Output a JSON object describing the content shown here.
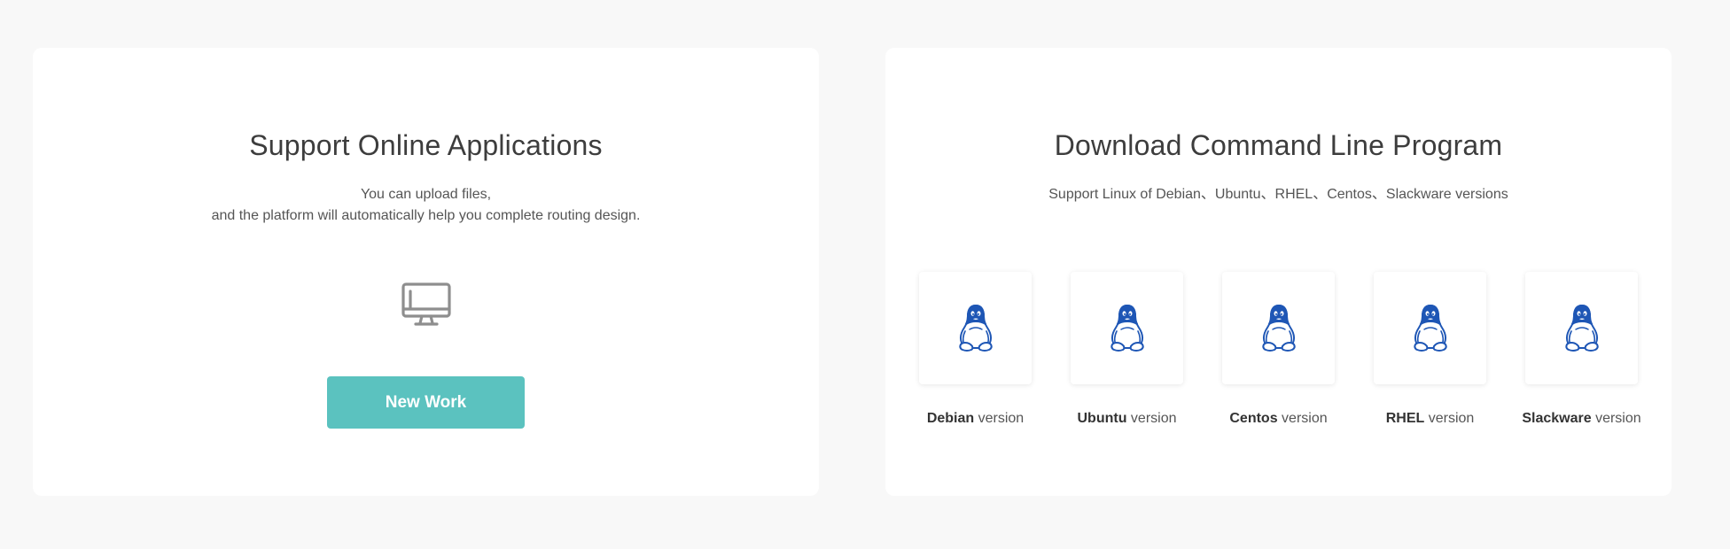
{
  "online": {
    "title": "Support Online Applications",
    "desc_line1": "You can upload files,",
    "desc_line2": "and the platform will automatically help you complete routing design.",
    "icon": "monitor-icon",
    "button_label": "New Work",
    "button_color": "#5bc2bf"
  },
  "download": {
    "title": "Download Command Line Program",
    "desc": "Support Linux of Debian、Ubuntu、RHEL、Centos、Slackware versions",
    "icon": "linux-penguin-icon",
    "icon_color": "#1e56b5",
    "version_suffix": "version",
    "items": [
      {
        "name": "Debian"
      },
      {
        "name": "Ubuntu"
      },
      {
        "name": "Centos"
      },
      {
        "name": "RHEL"
      },
      {
        "name": "Slackware"
      }
    ]
  },
  "colors": {
    "background": "#f8f8f8",
    "card": "#ffffff"
  }
}
